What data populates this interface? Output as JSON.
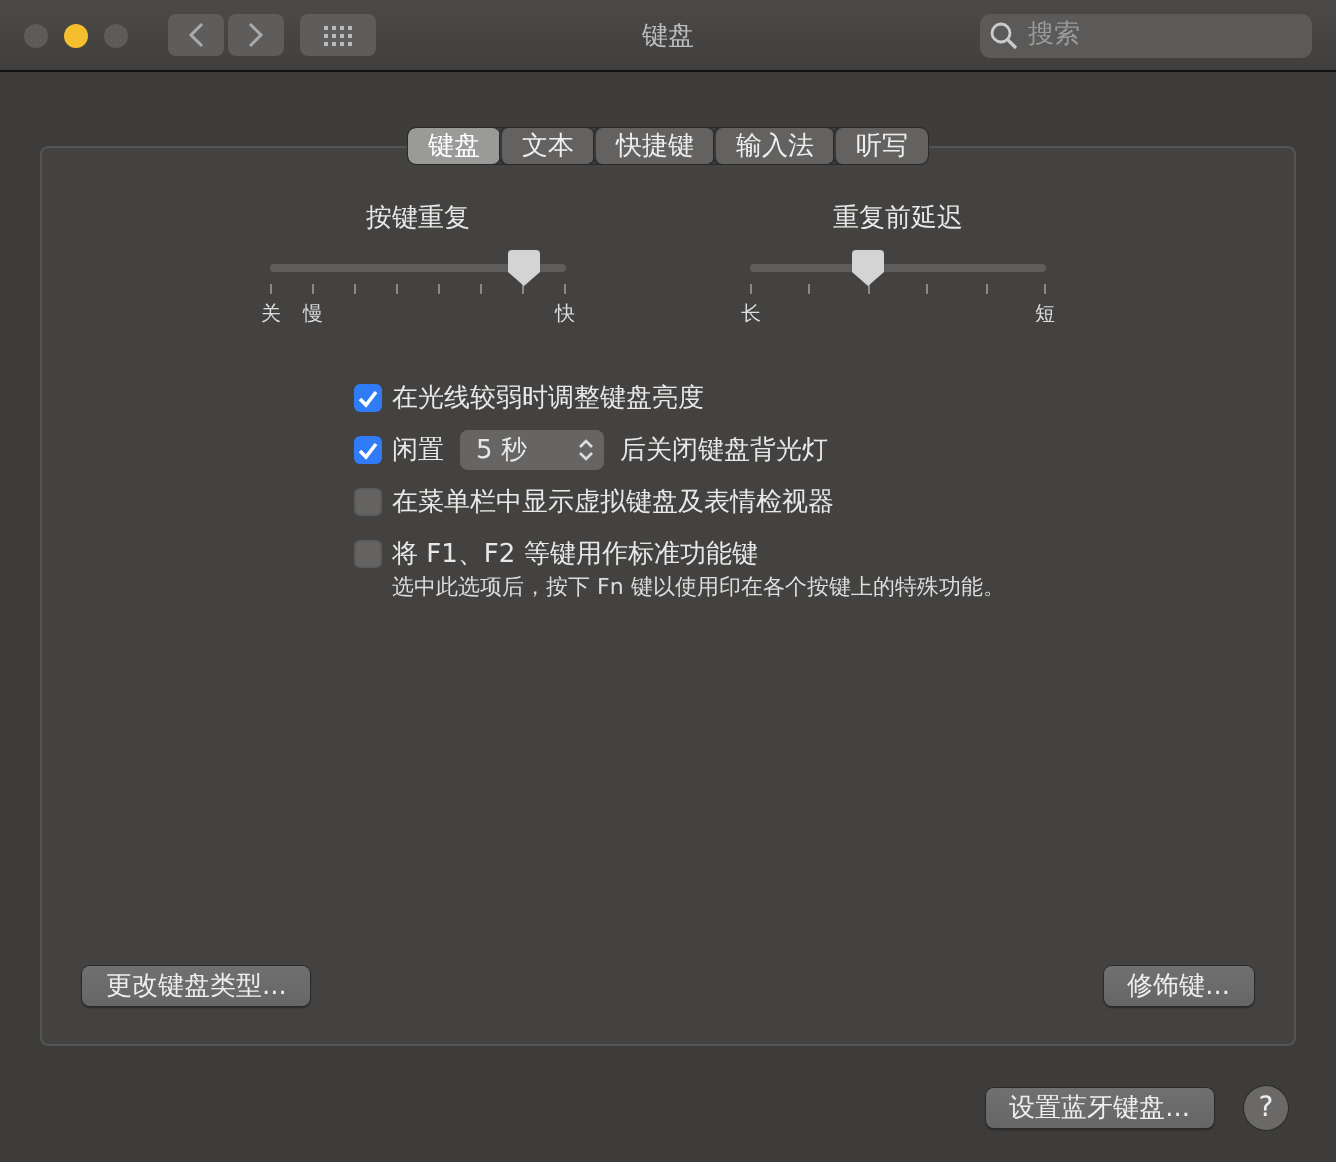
{
  "window": {
    "title": "键盘",
    "search": {
      "placeholder": "搜索"
    }
  },
  "tabs": [
    {
      "label": "键盘",
      "selected": true
    },
    {
      "label": "文本",
      "selected": false
    },
    {
      "label": "快捷键",
      "selected": false
    },
    {
      "label": "输入法",
      "selected": false
    },
    {
      "label": "听写",
      "selected": false
    }
  ],
  "sliders": [
    {
      "title": "按键重复",
      "level": 0.857,
      "start_labels": [
        "关",
        "慢"
      ],
      "end_label": "快"
    },
    {
      "title": "重复前延迟",
      "level": 0.4,
      "start_labels": [
        "长"
      ],
      "end_label": "短"
    }
  ],
  "options": [
    {
      "kind": "plain",
      "checked": true,
      "label": "在光线较弱时调整键盘亮度"
    },
    {
      "kind": "select",
      "checked": true,
      "label": "闲置",
      "select": "5 秒",
      "suffix": "后关闭键盘背光灯"
    },
    {
      "kind": "plain",
      "checked": false,
      "label": "在菜单栏中显示虚拟键盘及表情检视器"
    },
    {
      "kind": "note",
      "checked": false,
      "label": "将 F1、F2 等键用作标准功能键",
      "note": "选中此选项后，按下 Fn 键以使用印在各个按键上的特殊功能。"
    }
  ],
  "panel_buttons": [
    "更改键盘类型...",
    "修饰键..."
  ],
  "footer": {
    "button": "设置蓝牙键盘...",
    "help": "?"
  }
}
